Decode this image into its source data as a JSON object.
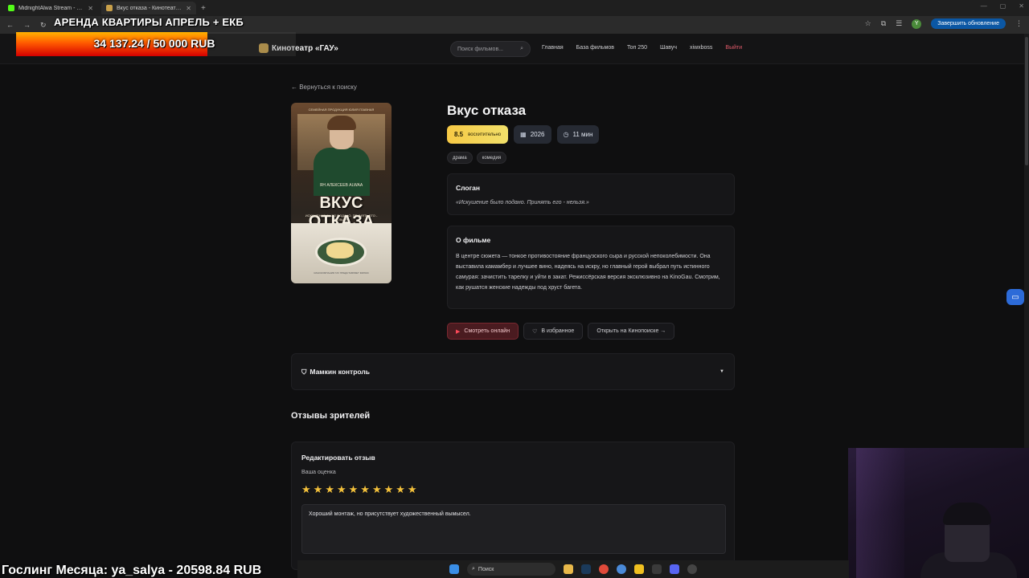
{
  "browser": {
    "tabs": [
      {
        "title": "MidnightAlwa Stream - Watch L",
        "active": false,
        "favicon_color": "#53fc18"
      },
      {
        "title": "Вкус отказа - Кинотеатр «ГАУ»",
        "active": true,
        "favicon_color": "#c9a04a"
      }
    ],
    "update_label": "Завершить обновление",
    "profile_initial": "Y"
  },
  "overlay": {
    "donate_title": "АРЕНДА КВАРТИРЫ АПРЕЛЬ + ЕКБ",
    "donate_amount": "34 137.24 / 50 000 RUB",
    "donate_progress": 0.683,
    "gosling": "Гослинг Месяца: ya_salya - 20598.84 RUB"
  },
  "site": {
    "brand": "Кинотеатр «ГАУ»",
    "search_placeholder": "Поиск фильмов...",
    "nav": [
      "Главная",
      "База фильмов",
      "Топ 250",
      "Шавуч",
      "xiwxboss",
      "Выйти"
    ]
  },
  "film": {
    "back": "← Вернуться к поиску",
    "title": "Вкус отказа",
    "rating_value": "8.5",
    "rating_label": "восхитительно",
    "year": "2026",
    "duration": "11 мин",
    "genres": [
      "драма",
      "комедия"
    ],
    "slogan_header": "Слоган",
    "slogan": "«Искушение было подано. Принять его - нельзя.»",
    "about_header": "О фильме",
    "about": "В центре сюжета — тонкое противостояние французского сыра и русской непоколебимости. Она выставила камамбер и лучшее вино, надеясь на искру, но главный герой выбрал путь истинного самурая: зачистить тарелку и уйти в закат. Режиссёрская версия эксклюзивно на KinoGau. Смотрим, как рушатся женские надежды под хруст багета.",
    "poster": {
      "top": "СЕМЕЙНАЯ ПРОДУКЦИЯ ЮЛИЯ ГЛАВНАЯ",
      "name": "ЯН АЛЕКСЕЕВ ALWAA",
      "title": "ВКУС ОТКАЗА",
      "tagline": "ИСКУШЕНИЕ БЫЛО ПОДАНО. ПРИНЯТЬ ЕГО - НЕЛЬЗЯ.",
      "bottom": "КИНОКОМПАНИЯ ГАУ ПРЕДСТАВЛЯЕТ ФИЛЬМ"
    },
    "actions": {
      "watch": "Смотреть онлайн",
      "favorite": "В избранное",
      "kinopoisk": "Открыть на Кинопоиске →"
    }
  },
  "mamkin": {
    "label": "Мамкин контроль",
    "caret": "▼"
  },
  "reviews": {
    "header": "Отзывы зрителей",
    "edit_header": "Редактировать отзыв",
    "your_rating": "Ваша оценка",
    "stars": 10,
    "text": "Хороший монтаж, но присутствует художественный вымысел."
  },
  "taskbar": {
    "search": "Поиск"
  },
  "colors": {
    "rating_gradient_start": "#f6c945",
    "watch_accent": "#ff4a5a",
    "logout": "#e05a6a",
    "star": "#f5c23b"
  }
}
